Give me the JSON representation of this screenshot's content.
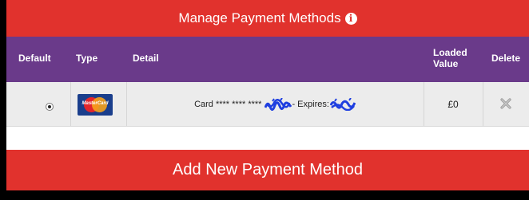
{
  "header": {
    "title": "Manage Payment Methods",
    "info_icon": "info-icon"
  },
  "table": {
    "columns": {
      "default": "Default",
      "type": "Type",
      "detail": "Detail",
      "loaded_value": "Loaded Value",
      "delete": "Delete"
    },
    "rows": [
      {
        "default_selected": true,
        "card_type": "Mastercard",
        "card_logo_text": "MasterCard",
        "detail_prefix": "Card **** **** ****",
        "detail_mid": "- Expires:",
        "loaded_value": "£0",
        "delete_icon": "close-icon"
      }
    ]
  },
  "actions": {
    "add_label": "Add New Payment Method"
  },
  "colors": {
    "header_red": "#e1322d",
    "table_header_purple": "#6a3a8a",
    "row_bg": "#ececec",
    "redaction_blue": "#1f3fe0"
  }
}
